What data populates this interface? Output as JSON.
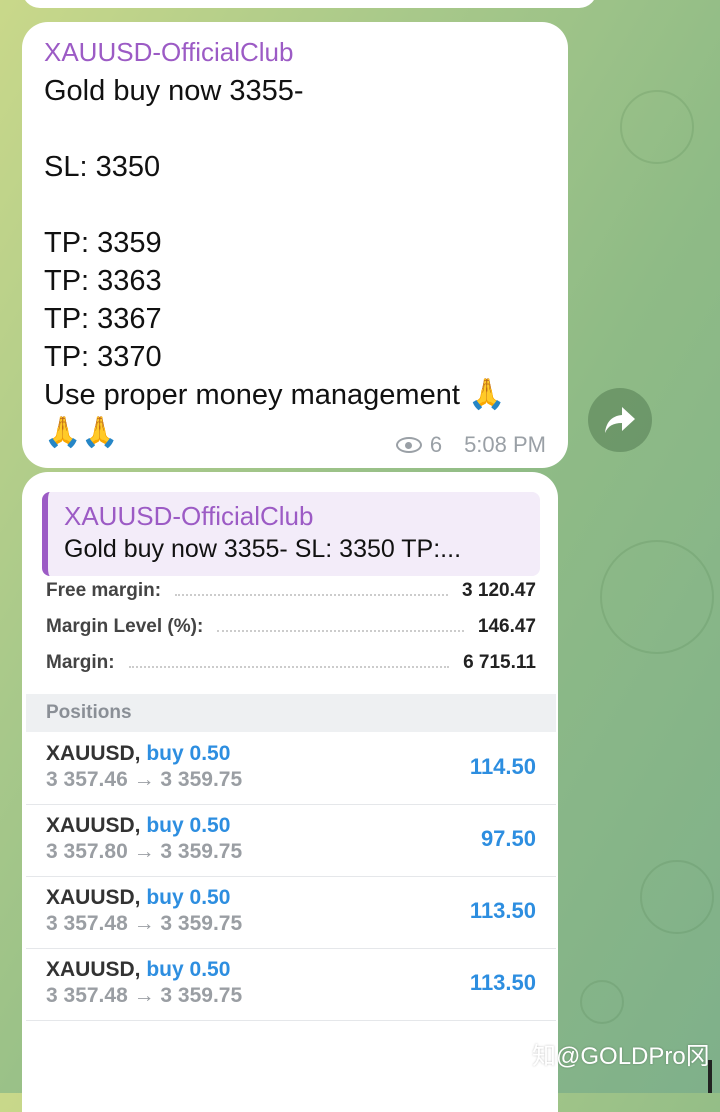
{
  "message1": {
    "sender": "XAUUSD-OfficialClub",
    "text": "Gold buy now 3355-\n\nSL: 3350\n\nTP: 3359\nTP: 3363\nTP: 3367\nTP: 3370\nUse proper money management ",
    "emoji_line1": "🙏",
    "emoji_line2": "🙏🙏",
    "views": "6",
    "time": "5:08 PM"
  },
  "message2": {
    "reply_sender": "XAUUSD-OfficialClub",
    "reply_text": "Gold buy now 3355-   SL: 3350  TP:...",
    "account": [
      {
        "label": "Free margin:",
        "value": "3 120.47"
      },
      {
        "label": "Margin Level (%):",
        "value": "146.47"
      },
      {
        "label": "Margin:",
        "value": "6 715.11"
      }
    ],
    "section_title": "Positions",
    "positions": [
      {
        "symbol": "XAUUSD,",
        "side": "buy 0.50",
        "prices": "3 357.46 → 3 359.75",
        "profit": "114.50"
      },
      {
        "symbol": "XAUUSD,",
        "side": "buy 0.50",
        "prices": "3 357.80 → 3 359.75",
        "profit": "97.50"
      },
      {
        "symbol": "XAUUSD,",
        "side": "buy 0.50",
        "prices": "3 357.48 → 3 359.75",
        "profit": "113.50"
      },
      {
        "symbol": "XAUUSD,",
        "side": "buy 0.50",
        "prices": "3 357.48 → 3 359.75",
        "profit": "113.50"
      }
    ]
  },
  "watermark": "知@GOLDPro冈",
  "colors": {
    "sender": "#9c5bc5",
    "buy": "#2d8ee0",
    "meta": "#9aa0a6"
  }
}
